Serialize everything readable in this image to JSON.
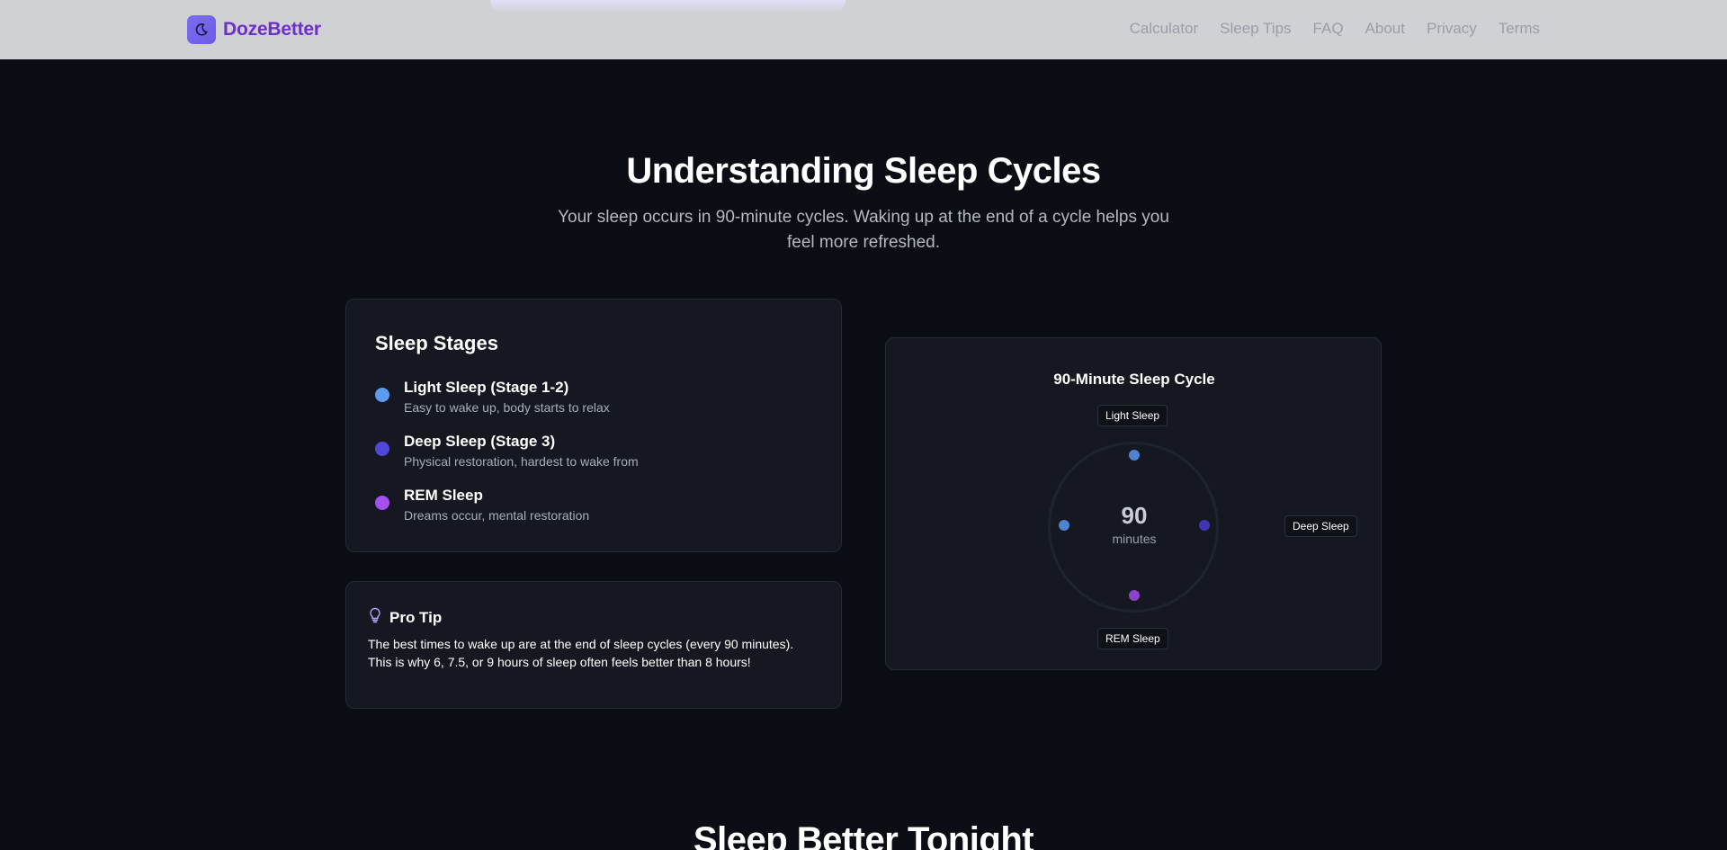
{
  "brand": {
    "name": "DozeBetter",
    "accent": "#6d5ce6",
    "name_color": "#6b31c4"
  },
  "nav": {
    "items": [
      "Calculator",
      "Sleep Tips",
      "FAQ",
      "About",
      "Privacy",
      "Terms"
    ]
  },
  "hero": {
    "title": "Understanding Sleep Cycles",
    "subtitle": "Your sleep occurs in 90-minute cycles. Waking up at the end of a cycle helps you feel more refreshed."
  },
  "stages": {
    "title": "Sleep Stages",
    "items": [
      {
        "name": "Light Sleep (Stage 1-2)",
        "desc": "Easy to wake up, body starts to relax",
        "color": "#5b9cf0"
      },
      {
        "name": "Deep Sleep (Stage 3)",
        "desc": "Physical restoration, hardest to wake from",
        "color": "#5046d8"
      },
      {
        "name": "REM Sleep",
        "desc": "Dreams occur, mental restoration",
        "color": "#a64ff0"
      }
    ]
  },
  "tip": {
    "icon": "lightbulb-icon",
    "title": "Pro Tip",
    "body": "The best times to wake up are at the end of sleep cycles (every 90 minutes). This is why 6, 7.5, or 9 hours of sleep often feels better than 8 hours!"
  },
  "cycle": {
    "title": "90-Minute Sleep Cycle",
    "center_value": "90",
    "center_unit": "minutes",
    "labels": {
      "top": "Light Sleep",
      "right": "Deep Sleep",
      "bottom": "REM Sleep"
    },
    "dot_colors": {
      "top": "#4f82cf",
      "right": "#4037b0",
      "bottom": "#8b43cc",
      "left": "#4f82cf"
    }
  },
  "next_section": {
    "title": "Sleep Better Tonight"
  }
}
